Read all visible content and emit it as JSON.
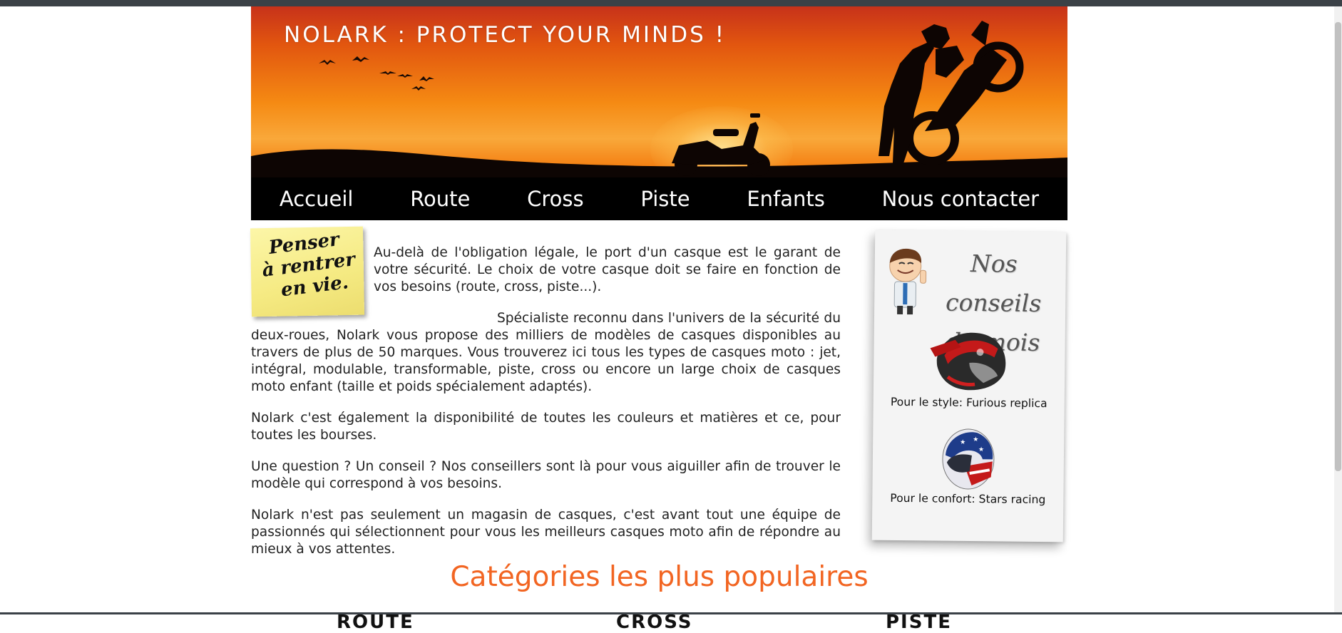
{
  "banner": {
    "title": "Nolark : Protect your minds !"
  },
  "nav": {
    "items": [
      {
        "label": "Accueil"
      },
      {
        "label": "Route"
      },
      {
        "label": "Cross"
      },
      {
        "label": "Piste"
      },
      {
        "label": "Enfants"
      },
      {
        "label": "Nous contacter"
      }
    ]
  },
  "sticky_note": {
    "lines": [
      "Penser",
      "à rentrer",
      "en vie."
    ]
  },
  "main": {
    "paragraphs": [
      "Au-delà de l'obligation légale, le port d'un casque est le garant de votre sécurité. Le choix de votre casque doit se faire en fonction de vos besoins (route, cross, piste...).",
      "Spécialiste reconnu dans l'univers de la sécurité du deux-roues, Nolark vous propose des milliers de modèles de casques disponibles au travers de plus de 50 marques. Vous trouverez ici tous les types de casques moto : jet, intégral, modulable, transformable, piste, cross ou encore un large choix de casques moto enfant (taille et poids spécialement adaptés).",
      "Nolark c'est également la disponibilité de toutes les couleurs et matières et ce, pour toutes les bourses.",
      "Une question ? Un conseil ? Nos conseillers sont là pour vous aiguiller afin de trouver le modèle qui correspond à vos besoins.",
      "Nolark n'est pas seulement un magasin de casques, c'est avant tout une équipe de passionnés qui sélectionnent pour vous les meilleurs casques moto afin de répondre au mieux à vos attentes."
    ],
    "section_title": "Catégories les plus populaires",
    "cut_headings": [
      "ROUTE",
      "CROSS",
      "PISTE"
    ]
  },
  "aside": {
    "title_line1": "Nos conseils",
    "title_line2": "du mois",
    "items": [
      {
        "caption": "Pour le style: Furious replica",
        "icon": "cross-helmet-red-icon"
      },
      {
        "caption": "Pour le confort: Stars racing",
        "icon": "integral-helmet-stars-icon"
      }
    ]
  },
  "colors": {
    "accent": "#f26522",
    "nav_bg": "#000000",
    "nav_text": "#ffffff",
    "text": "#222222"
  }
}
